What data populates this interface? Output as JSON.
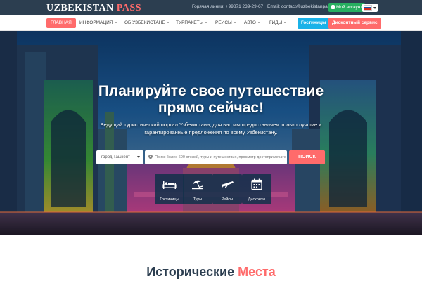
{
  "header": {
    "logo_word1": "UZBEKISTAN",
    "logo_word2": "PASS",
    "hotline": "Горячая линия: +99871 239-29-67",
    "email": "Email: contact@uzbekistanpass.com",
    "account_label": "Мой аккаунт",
    "language": "ru",
    "colors": {
      "bar": "#2c3e50",
      "accent": "#ff6b6b",
      "account": "#27ae60"
    }
  },
  "nav": {
    "items": [
      {
        "label": "ГЛАВНАЯ",
        "active": true,
        "dropdown": false
      },
      {
        "label": "ИНФОРМАЦИЯ",
        "active": false,
        "dropdown": true
      },
      {
        "label": "ОБ УЗБЕКИСТАНЕ",
        "active": false,
        "dropdown": true
      },
      {
        "label": "ТУРПАКЕТЫ",
        "active": false,
        "dropdown": true
      },
      {
        "label": "РЕЙСЫ",
        "active": false,
        "dropdown": true
      },
      {
        "label": "АВТО",
        "active": false,
        "dropdown": true
      },
      {
        "label": "ГИДЫ",
        "active": false,
        "dropdown": true
      }
    ],
    "hotels_button": "Гостиницы",
    "discount_button": "Дисконтный сервис",
    "colors": {
      "hotels": "#1ab2e8",
      "discount": "#ff6b6b"
    }
  },
  "hero": {
    "title_line1": "Планируйте свое путешествие",
    "title_line2": "прямо сейчас!",
    "subtitle": "Ведущий туристический портал Узбекистана, для вас мы предоставляем только лучшие и гарантированные предложения по всему Узбекистану.",
    "city_select": "город Ташкент",
    "search_placeholder": "Поиск более 600 отелей, туры и путешествия, просмотр достопримечатель...",
    "search_button": "ПОИСК",
    "categories": [
      {
        "label": "Гостиницы",
        "icon": "bed-icon"
      },
      {
        "label": "Туры",
        "icon": "beach-umbrella-icon"
      },
      {
        "label": "Рейсы",
        "icon": "airplane-icon"
      },
      {
        "label": "Дисконты",
        "icon": "calendar-icon"
      }
    ]
  },
  "section": {
    "title_word1": "Исторические",
    "title_word2": "Места"
  }
}
